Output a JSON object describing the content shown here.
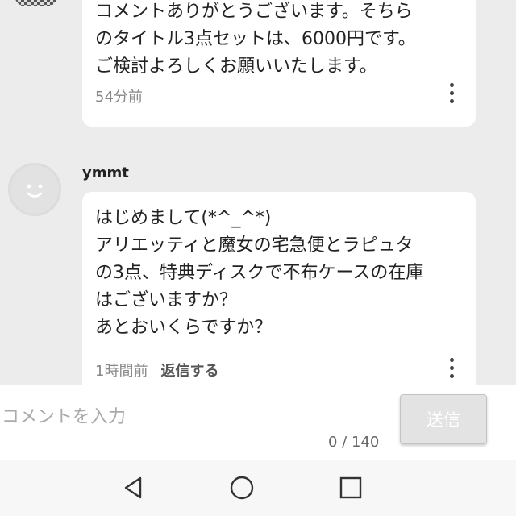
{
  "comments": [
    {
      "body": "コメントありがとうございます。そちら\nのタイトル3点セットは、6000円です。\nご検討よろしくお願いいたします。",
      "time": "54分前"
    },
    {
      "user": "ymmt",
      "body": "はじめまして(*^_^*)\nアリエッティと魔女の宅急便とラピュタ\nの3点、特典ディスクで不布ケースの在庫\nはございますか？\nあとおいくらですか？",
      "time": "1時間前",
      "reply_label": "返信する"
    }
  ],
  "composer": {
    "placeholder": "コメントを入力",
    "send_label": "送信",
    "counter": "0 / 140"
  },
  "nav": {
    "icons": [
      "back-triangle-icon",
      "home-circle-icon",
      "recent-apps-square-icon"
    ]
  },
  "colors": {
    "background": "#ececec",
    "bubble": "#ffffff",
    "send_button": "#e3e3e3"
  }
}
